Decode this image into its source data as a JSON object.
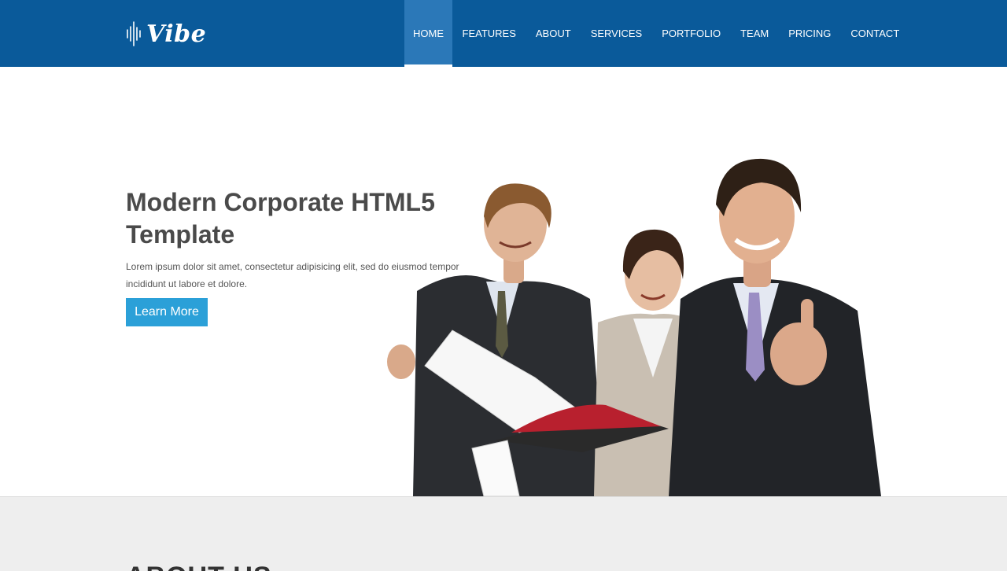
{
  "brand": {
    "logo_text": "Vibe"
  },
  "nav": {
    "items": [
      {
        "label": "HOME",
        "active": true
      },
      {
        "label": "FEATURES"
      },
      {
        "label": "ABOUT"
      },
      {
        "label": "SERVICES"
      },
      {
        "label": "PORTFOLIO"
      },
      {
        "label": "TEAM"
      },
      {
        "label": "PRICING"
      },
      {
        "label": "CONTACT"
      }
    ]
  },
  "hero": {
    "title": "Modern Corporate HTML5 Template",
    "description": "Lorem ipsum dolor sit amet, consectetur adipisicing elit, sed do eiusmod tempor incididunt ut labore et dolore.",
    "button_label": "Learn More",
    "image": "business-team-illustration"
  },
  "about": {
    "title": "ABOUT US"
  },
  "colors": {
    "header_bg": "#0a5a9a",
    "nav_active_bg": "#2b78b8",
    "button_bg": "#2ba0d8",
    "about_bg": "#eeeeee"
  }
}
